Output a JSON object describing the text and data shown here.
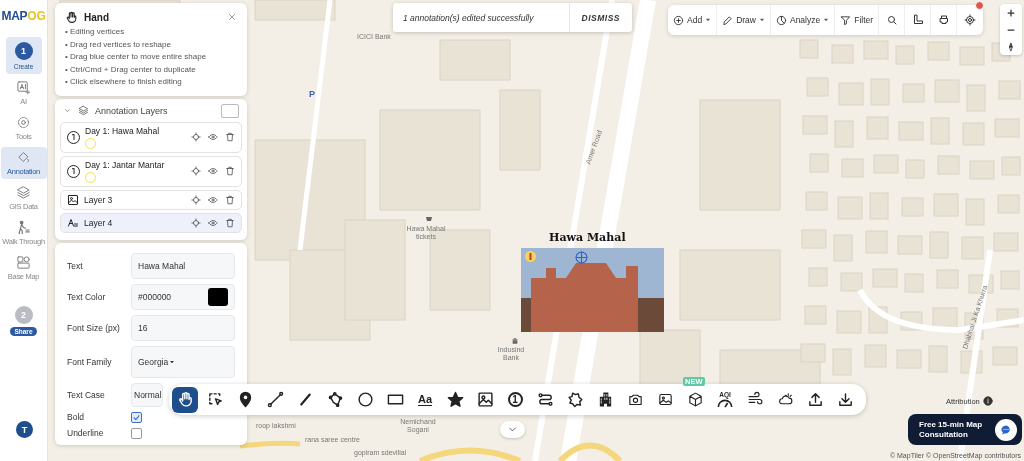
{
  "logo": {
    "main": "MAP",
    "accent": "OG"
  },
  "nav": {
    "steps": [
      {
        "number": "1",
        "label": "Create",
        "selected": true
      },
      {
        "number": "2",
        "label": "Share",
        "selected": false
      }
    ],
    "items": [
      {
        "kind": "ai",
        "label": "AI",
        "selected": false
      },
      {
        "kind": "tools",
        "label": "Tools",
        "selected": false
      },
      {
        "kind": "annotation",
        "label": "Annotation",
        "selected": true
      },
      {
        "kind": "gis",
        "label": "GIS Data",
        "selected": false
      },
      {
        "kind": "walk",
        "label": "Walk Through",
        "selected": false
      },
      {
        "kind": "basemap",
        "label": "Base Map",
        "selected": false
      }
    ],
    "avatar": "T"
  },
  "hint": {
    "title": "Hand",
    "lines": [
      "• Editing vertices",
      "• Drag red vertices to reshape",
      "• Drag blue center to move entire shape",
      "• Ctrl/Cmd + Drag center to duplicate",
      "• Click elsewhere to finish editing"
    ]
  },
  "layers_panel": {
    "title": "Annotation Layers",
    "expanded": true,
    "select_all_checked": false,
    "layers": [
      {
        "kind": "number",
        "name": "Day 1: Hawa Mahal",
        "selected": false
      },
      {
        "kind": "number",
        "name": "Day 1: Jantar Mantar",
        "selected": false
      },
      {
        "kind": "image",
        "name": "Layer 3",
        "selected": false
      },
      {
        "kind": "text",
        "name": "Layer 4",
        "selected": true
      }
    ]
  },
  "properties": {
    "fields": [
      {
        "kind": "text",
        "label": "Text",
        "value": "Hawa Mahal"
      },
      {
        "kind": "color",
        "label": "Text Color",
        "value": "#000000"
      },
      {
        "kind": "text",
        "label": "Font Size (px)",
        "value": "16"
      },
      {
        "kind": "select",
        "label": "Font Family",
        "value": "Georgia"
      },
      {
        "kind": "text",
        "label": "Text Case",
        "value": "Normal"
      },
      {
        "kind": "checkbox",
        "label": "Bold",
        "checked": true
      },
      {
        "kind": "checkbox",
        "label": "Underline",
        "checked": false
      }
    ]
  },
  "toast": {
    "message": "1 annotation(s) edited successfully",
    "action": "DISMISS"
  },
  "toolbar": {
    "menus": [
      {
        "kind": "add",
        "label": "Add",
        "dropdown": true
      },
      {
        "kind": "draw",
        "label": "Draw",
        "dropdown": true
      },
      {
        "kind": "analyze",
        "label": "Analyze",
        "dropdown": true
      },
      {
        "kind": "filter",
        "label": "Filter",
        "dropdown": false
      }
    ],
    "icons": [
      {
        "kind": "search",
        "alert": false
      },
      {
        "kind": "measure",
        "alert": false
      },
      {
        "kind": "print",
        "alert": false
      },
      {
        "kind": "locate",
        "alert": true
      }
    ]
  },
  "map": {
    "labels": [
      {
        "kind": "poi",
        "text": "ICICI Bank"
      },
      {
        "kind": "parking",
        "text": "P"
      },
      {
        "kind": "poi",
        "text": "Hawa Mahal tickets"
      },
      {
        "kind": "road",
        "text": "Amer Road"
      },
      {
        "kind": "poi",
        "text": "Indusind Bank"
      },
      {
        "kind": "poi",
        "text": "roop lakshmi"
      },
      {
        "kind": "poi",
        "text": "Nemichand Sogani"
      },
      {
        "kind": "poi",
        "text": "rana saree centre"
      },
      {
        "kind": "poi",
        "text": "gopiram sdevillal"
      },
      {
        "kind": "road",
        "text": "Dhabhai Ji Ka Khurra"
      }
    ]
  },
  "annotation": {
    "title": "Hawa Mahal"
  },
  "tools": [
    {
      "kind": "hand",
      "selected": true
    },
    {
      "kind": "select",
      "selected": false
    },
    {
      "kind": "pin",
      "selected": false
    },
    {
      "kind": "line",
      "selected": false
    },
    {
      "kind": "pen",
      "selected": false
    },
    {
      "kind": "polygon",
      "selected": false
    },
    {
      "kind": "circle",
      "selected": false
    },
    {
      "kind": "rectangle",
      "selected": false
    },
    {
      "kind": "text",
      "label": "Aa",
      "selected": false
    },
    {
      "kind": "star",
      "selected": false
    },
    {
      "kind": "image",
      "selected": false
    },
    {
      "kind": "number",
      "label": "1",
      "selected": false
    },
    {
      "kind": "route",
      "selected": false
    },
    {
      "kind": "shape",
      "selected": false
    },
    {
      "kind": "building",
      "selected": false
    },
    {
      "kind": "camera",
      "selected": false
    },
    {
      "kind": "photo",
      "selected": false
    },
    {
      "kind": "cube",
      "badge": "NEW",
      "selected": false
    },
    {
      "kind": "aqi",
      "label": "AQI",
      "selected": false
    },
    {
      "kind": "wind",
      "selected": false
    },
    {
      "kind": "weather",
      "selected": false
    },
    {
      "kind": "upload",
      "selected": false
    },
    {
      "kind": "download",
      "selected": false
    }
  ],
  "consult": {
    "label": "Free 15-min Map Consultation"
  },
  "attribution": {
    "label": "Attribution"
  },
  "copyright": "© MapTiler © OpenStreetMap contributors"
}
